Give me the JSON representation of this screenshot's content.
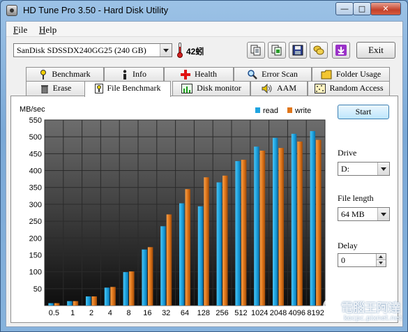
{
  "window": {
    "title": "HD Tune Pro 3.50 - Hard Disk Utility"
  },
  "menu": {
    "file": "File",
    "help": "Help"
  },
  "toolbar": {
    "drive_selected": "SanDisk SDSSDX240GG25 (240 GB)",
    "temperature": "42蚓",
    "exit_label": "Exit"
  },
  "tabs": [
    {
      "label": "Benchmark",
      "icon": "benchmark-icon"
    },
    {
      "label": "Info",
      "icon": "info-icon"
    },
    {
      "label": "Health",
      "icon": "health-cross-icon"
    },
    {
      "label": "Error Scan",
      "icon": "magnifier-icon"
    },
    {
      "label": "Folder Usage",
      "icon": "folder-icon"
    },
    {
      "label": "Erase",
      "icon": "trash-icon"
    },
    {
      "label": "File Benchmark",
      "icon": "file-benchmark-icon"
    },
    {
      "label": "Disk monitor",
      "icon": "disk-monitor-icon"
    },
    {
      "label": "AAM",
      "icon": "speaker-icon"
    },
    {
      "label": "Random Access",
      "icon": "random-access-icon"
    }
  ],
  "active_tab": "File Benchmark",
  "side": {
    "start_label": "Start",
    "drive_label": "Drive",
    "drive_value": "D:",
    "file_length_label": "File length",
    "file_length_value": "64 MB",
    "delay_label": "Delay",
    "delay_value": "0"
  },
  "watermark": {
    "main": "電腦王阿達",
    "sub": "kocpc.pixnet.net"
  },
  "colors": {
    "read": "#1fa4e0",
    "write": "#e0761a",
    "plot_bg_top": "#6d6d6d",
    "plot_bg_bottom": "#0e0e0e"
  },
  "chart_data": {
    "type": "bar",
    "ylabel": "MB/sec",
    "ylim": [
      0,
      550
    ],
    "yticks": [
      50,
      100,
      150,
      200,
      250,
      300,
      350,
      400,
      450,
      500,
      550
    ],
    "categories": [
      "0.5",
      "1",
      "2",
      "4",
      "8",
      "16",
      "32",
      "64",
      "128",
      "256",
      "512",
      "1024",
      "2048",
      "4096",
      "8192"
    ],
    "series": [
      {
        "name": "read",
        "values": [
          7,
          13,
          27,
          53,
          99,
          166,
          235,
          303,
          294,
          365,
          428,
          471,
          497,
          509,
          517
        ]
      },
      {
        "name": "write",
        "values": [
          7,
          13,
          27,
          55,
          101,
          173,
          270,
          345,
          380,
          385,
          432,
          459,
          467,
          486,
          491
        ]
      }
    ],
    "legend_position": "top-right",
    "grid": true
  }
}
